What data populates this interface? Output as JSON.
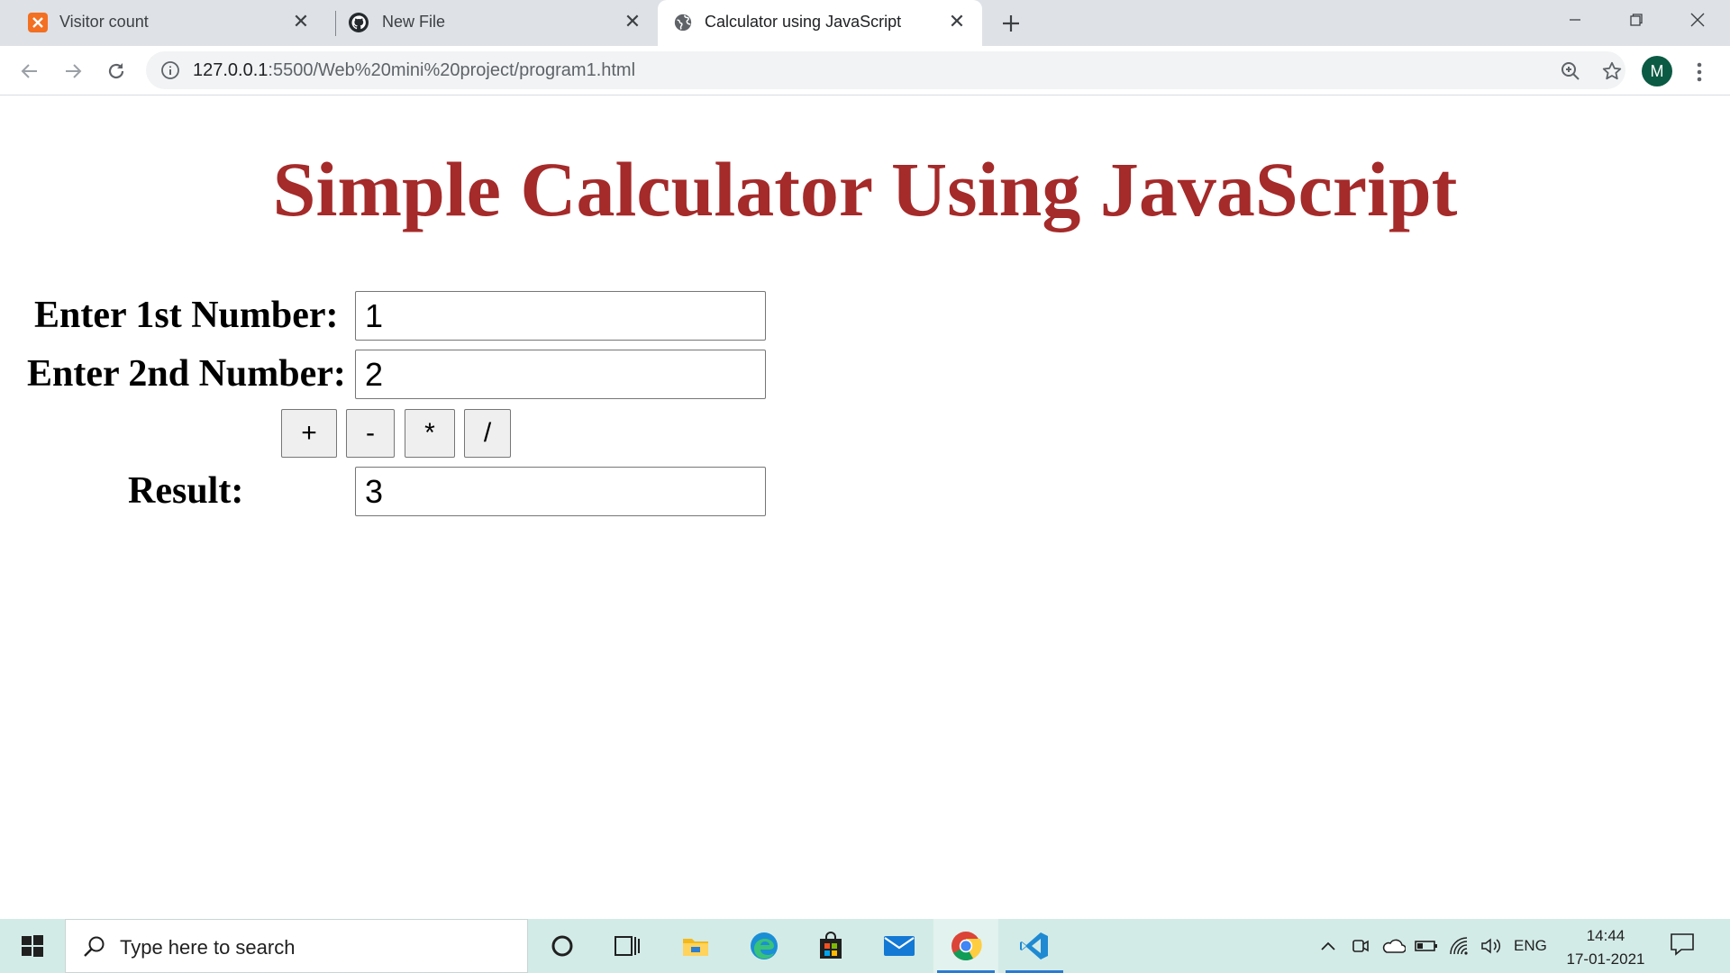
{
  "browser": {
    "tabs": [
      {
        "title": "Visitor count",
        "icon": "xampp-icon"
      },
      {
        "title": "New File",
        "icon": "github-icon"
      },
      {
        "title": "Calculator using JavaScript",
        "icon": "globe-icon",
        "active": true
      }
    ],
    "url_host": "127.0.0.1",
    "url_path": ":5500/Web%20mini%20project/program1.html",
    "avatar_letter": "M"
  },
  "page": {
    "title": "Simple Calculator Using JavaScript",
    "label_first": "Enter 1st Number:",
    "label_second": "Enter 2nd Number:",
    "label_result": "Result:",
    "value_first": "1",
    "value_second": "2",
    "value_result": "3",
    "ops": {
      "add": "+",
      "sub": "-",
      "mul": "*",
      "div": "/"
    },
    "title_color": "#a52a2a"
  },
  "taskbar": {
    "search_placeholder": "Type here to search",
    "lang": "ENG",
    "time": "14:44",
    "date": "17-01-2021"
  }
}
